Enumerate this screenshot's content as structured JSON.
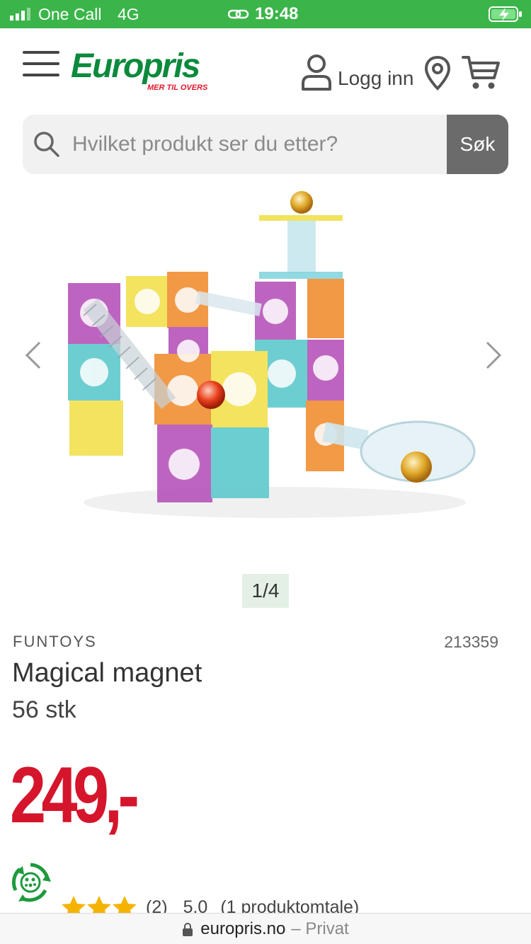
{
  "status_bar": {
    "carrier": "One Call",
    "network": "4G",
    "time": "19:48"
  },
  "header": {
    "logo_text": "Europris",
    "logo_tagline": "MER TIL OVERS",
    "login_label": "Logg inn",
    "icons": [
      "menu-icon",
      "user-icon",
      "location-icon",
      "cart-icon"
    ]
  },
  "search": {
    "placeholder": "Hvilket produkt ser du etter?",
    "value": "",
    "button_label": "Søk"
  },
  "gallery": {
    "pager": "1/4",
    "current_image": 1,
    "total_images": 4
  },
  "product": {
    "brand": "FUNTOYS",
    "sku": "213359",
    "title": "Magical magnet",
    "quantity": "56 stk",
    "price": "249,-",
    "rating_count": "(2)",
    "rating_score": "5.0",
    "review_count": "(1 produktomtale)",
    "stars": 5
  },
  "url_bar": {
    "domain": "europris.no",
    "mode": "– Privat"
  },
  "colors": {
    "status_bar": "#3bb54a",
    "brand_green": "#0b8a3c",
    "price_red": "#d5152b",
    "search_button": "#6b6b6b",
    "star": "#f5b301"
  }
}
